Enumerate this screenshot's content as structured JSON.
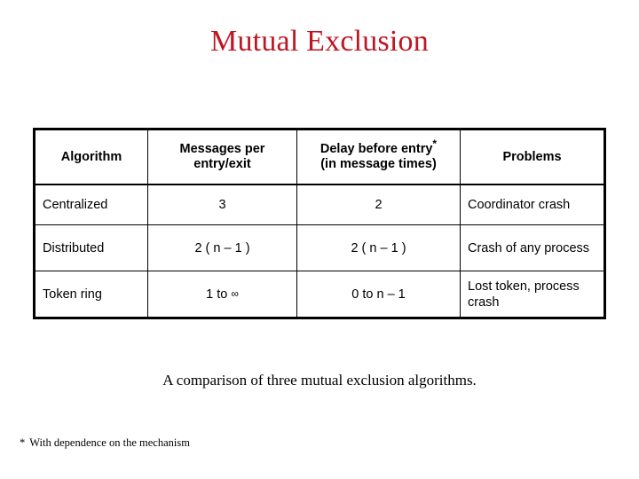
{
  "slide": {
    "title": "Mutual Exclusion",
    "title_color": "#BE1622",
    "background_color": "#FFFFFF",
    "caption": "A comparison of three mutual exclusion algorithms.",
    "footnote_marker": "*",
    "footnote_text": "With dependence on the mechanism"
  },
  "table": {
    "border_color": "#000000",
    "headers": [
      {
        "line1": "Algorithm",
        "line2": ""
      },
      {
        "line1": "Messages per",
        "line2": "entry/exit"
      },
      {
        "line1": "Delay before entry",
        "marker": "*",
        "line2": "(in message times)"
      },
      {
        "line1": "Problems",
        "line2": ""
      }
    ],
    "rows": [
      {
        "algorithm": "Centralized",
        "messages": "3",
        "delay": "2",
        "problems": "Coordinator crash"
      },
      {
        "algorithm": "Distributed",
        "messages": "2 ( n – 1 )",
        "delay": "2 ( n – 1 )",
        "problems": "Crash of any process"
      },
      {
        "algorithm": "Token ring",
        "messages_prefix": "1 to",
        "messages_symbol": "∞",
        "delay": "0 to n – 1",
        "problems": "Lost token, process crash"
      }
    ]
  }
}
